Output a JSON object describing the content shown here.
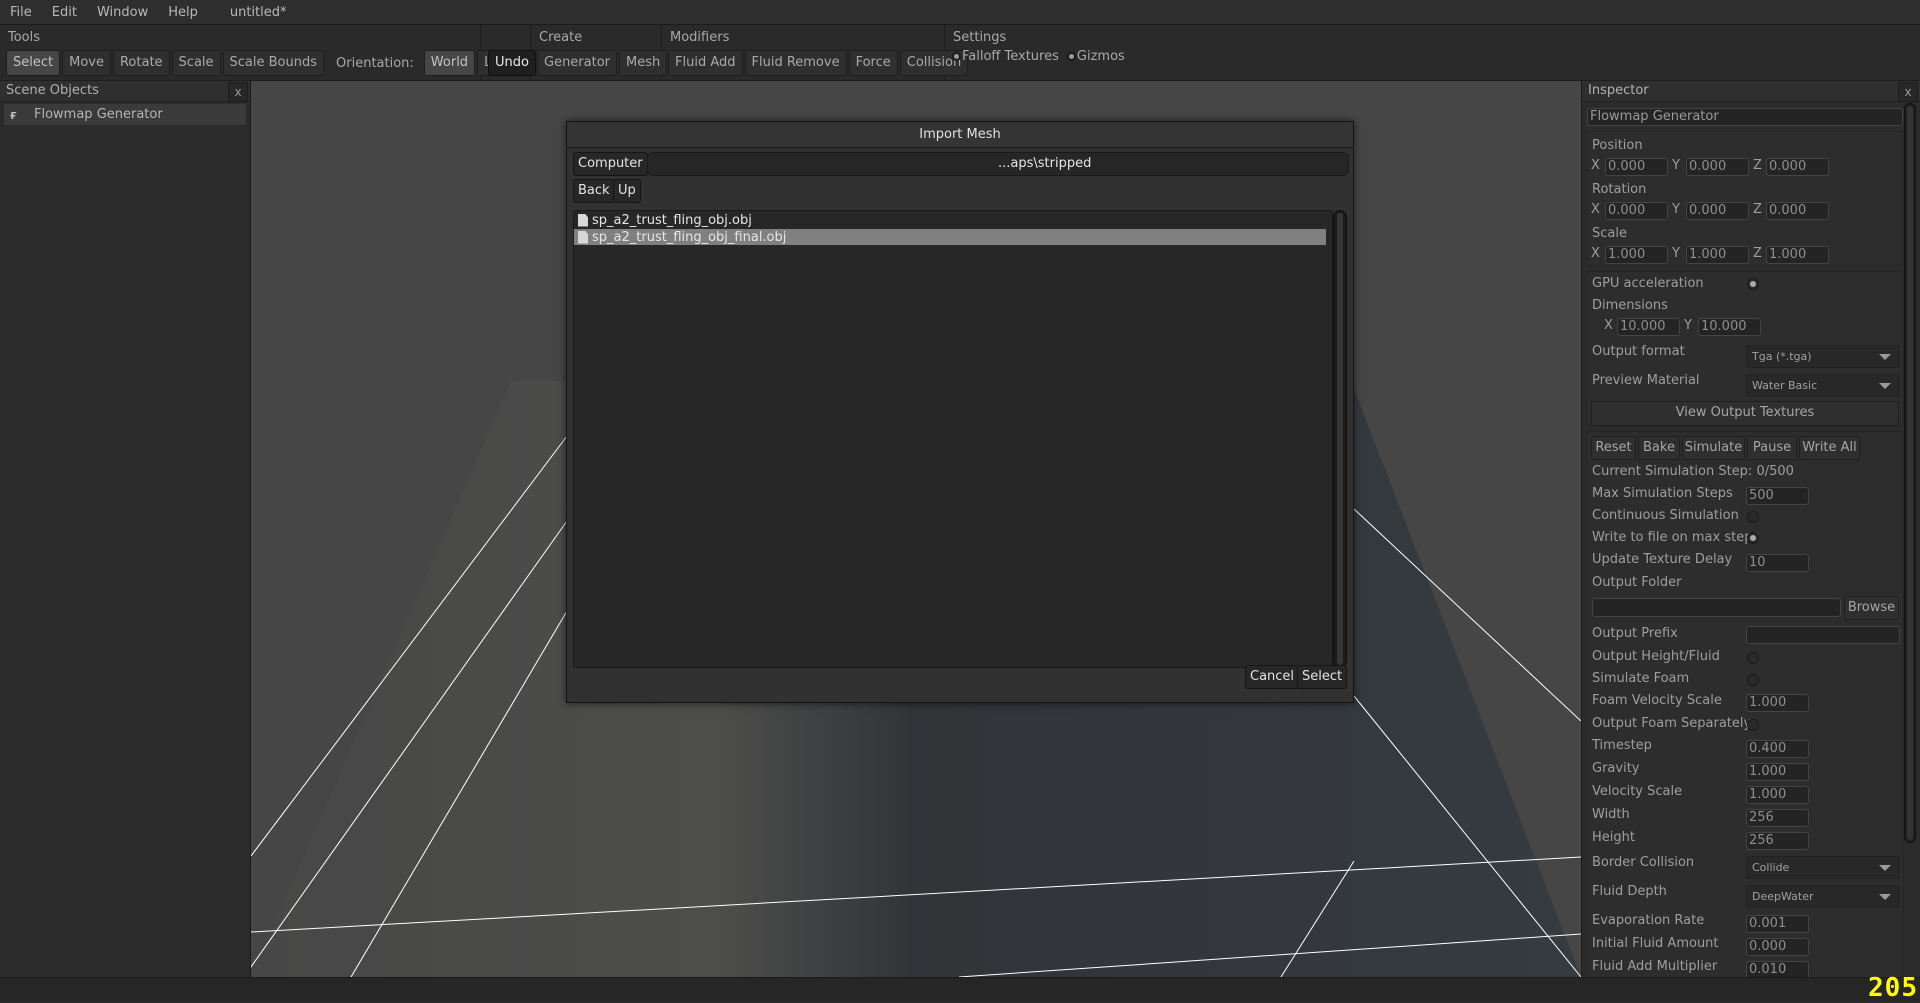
{
  "menu": {
    "items": [
      "File",
      "Edit",
      "Window",
      "Help"
    ],
    "doc_title": "untitled*"
  },
  "toolbar": {
    "tools": {
      "label": "Tools",
      "buttons": [
        "Select",
        "Move",
        "Rotate",
        "Scale",
        "Scale Bounds"
      ],
      "active": "Select",
      "orientation_label": "Orientation:",
      "orientation_options": [
        "World",
        "Local"
      ],
      "orientation_active": "World"
    },
    "undo_label": "Undo",
    "create": {
      "label": "Create",
      "buttons": [
        "Generator",
        "Mesh"
      ]
    },
    "modifiers": {
      "label": "Modifiers",
      "buttons": [
        "Fluid Add",
        "Fluid Remove",
        "Force",
        "Collision"
      ]
    },
    "settings": {
      "label": "Settings",
      "toggles": [
        {
          "label": "Falloff Textures",
          "checked": true
        },
        {
          "label": "Gizmos",
          "checked": true
        }
      ]
    }
  },
  "scene_objects": {
    "title": "Scene Objects",
    "close_label": "x",
    "items": [
      {
        "label": "Flowmap Generator",
        "icon": "flowmap-generator-icon"
      }
    ]
  },
  "dialog": {
    "title": "Import Mesh",
    "computer_label": "Computer",
    "path_value": "...aps\\stripped",
    "back_label": "Back",
    "up_label": "Up",
    "files": [
      {
        "name": "sp_a2_trust_fling_obj.obj",
        "selected": false
      },
      {
        "name": "sp_a2_trust_fling_obj_final.obj",
        "selected": true
      }
    ],
    "cancel_label": "Cancel",
    "select_label": "Select"
  },
  "inspector": {
    "title": "Inspector",
    "close_label": "x",
    "object_name": "Flowmap Generator",
    "position": {
      "label": "Position",
      "x": "0.000",
      "y": "0.000",
      "z": "0.000"
    },
    "rotation": {
      "label": "Rotation",
      "x": "0.000",
      "y": "0.000",
      "z": "0.000"
    },
    "scale": {
      "label": "Scale",
      "x": "1.000",
      "y": "1.000",
      "z": "1.000"
    },
    "axis": {
      "x": "X",
      "y": "Y",
      "z": "Z"
    },
    "gpu_acceleration": {
      "label": "GPU acceleration",
      "checked": true
    },
    "dimensions": {
      "label": "Dimensions",
      "x": "10.000",
      "y": "10.000"
    },
    "output_format": {
      "label": "Output format",
      "value": "Tga (*.tga)"
    },
    "preview_material": {
      "label": "Preview Material",
      "value": "Water Basic"
    },
    "view_output_textures": "View Output Textures",
    "sim_buttons": [
      "Reset",
      "Bake",
      "Simulate",
      "Pause",
      "Write All"
    ],
    "current_step": "Current Simulation Step: 0/500",
    "max_steps": {
      "label": "Max Simulation Steps",
      "value": "500"
    },
    "continuous_sim": {
      "label": "Continuous Simulation",
      "checked": false
    },
    "write_on_max": {
      "label": "Write to file on max steps",
      "checked": true
    },
    "update_texture_delay": {
      "label": "Update Texture Delay",
      "value": "10"
    },
    "output_folder": {
      "label": "Output Folder",
      "value": "",
      "browse_label": "Browse"
    },
    "output_prefix": {
      "label": "Output Prefix",
      "value": ""
    },
    "output_height_fluid": {
      "label": "Output Height/Fluid",
      "checked": false
    },
    "simulate_foam": {
      "label": "Simulate Foam",
      "checked": false
    },
    "foam_velocity_scale": {
      "label": "Foam Velocity Scale",
      "value": "1.000"
    },
    "output_foam_separately": {
      "label": "Output Foam Separately",
      "checked": false
    },
    "timestep": {
      "label": "Timestep",
      "value": "0.400"
    },
    "gravity": {
      "label": "Gravity",
      "value": "1.000"
    },
    "velocity_scale": {
      "label": "Velocity Scale",
      "value": "1.000"
    },
    "width": {
      "label": "Width",
      "value": "256"
    },
    "height": {
      "label": "Height",
      "value": "256"
    },
    "border_collision": {
      "label": "Border Collision",
      "value": "Collide"
    },
    "fluid_depth": {
      "label": "Fluid Depth",
      "value": "DeepWater"
    },
    "evaporation_rate": {
      "label": "Evaporation Rate",
      "value": "0.001"
    },
    "initial_fluid_amount": {
      "label": "Initial Fluid Amount",
      "value": "0.000"
    },
    "fluid_add_multiplier": {
      "label": "Fluid Add Multiplier",
      "value": "0.010"
    }
  },
  "fps_counter": "205"
}
